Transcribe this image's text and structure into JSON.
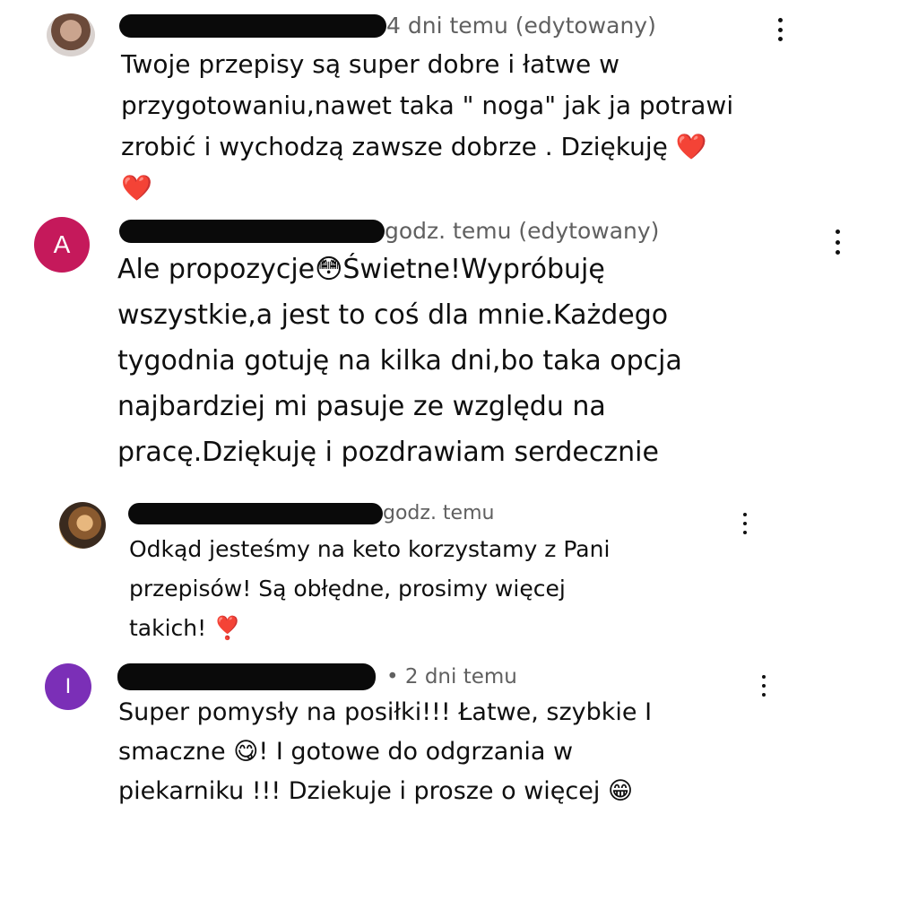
{
  "comments": [
    {
      "meta": "4 dni temu (edytowany)",
      "lines": [
        "Twoje przepisy są super dobre i łatwe w",
        "przygotowaniu,nawet taka \" noga\" jak ja potrawi",
        "zrobić i wychodzą zawsze dobrze . Dziękuję"
      ],
      "emoji_end": "❤️",
      "emoji_line": "❤️"
    },
    {
      "avatar_letter": "A",
      "meta": "godz. temu (edytowany)",
      "line1_pre": "Ale propozycje",
      "emoji_flushed": "😳",
      "line1_post": "Świetne!Wypróbuję",
      "lines": [
        "wszystkie,a jest to coś dla mnie.Każdego",
        "tygodnia gotuję na kilka dni,bo taka opcja",
        "najbardziej mi pasuje ze względu na",
        "pracę.Dziękuję i pozdrawiam serdecznie"
      ]
    },
    {
      "meta": "godz. temu",
      "lines": [
        "Odkąd jesteśmy na keto korzystamy z Pani",
        "przepisów! Są obłędne, prosimy więcej"
      ],
      "last_line": "takich!",
      "emoji_exclaim": "❣️"
    },
    {
      "avatar_letter": "I",
      "meta": "• 2 dni temu",
      "line1": "Super pomysły na posiłki!!! Łatwe, szybkie I",
      "line2_pre": "smaczne",
      "emoji_yum": "😋",
      "line2_post": "! I gotowe do odgrzania w",
      "line3": "piekarniku !!! Dziekuje i prosze o więcej",
      "emoji_grin": "😁"
    }
  ],
  "colors": {
    "avatar_a": "#c5195b",
    "avatar_i": "#7b2fb7",
    "meta": "#606060"
  }
}
